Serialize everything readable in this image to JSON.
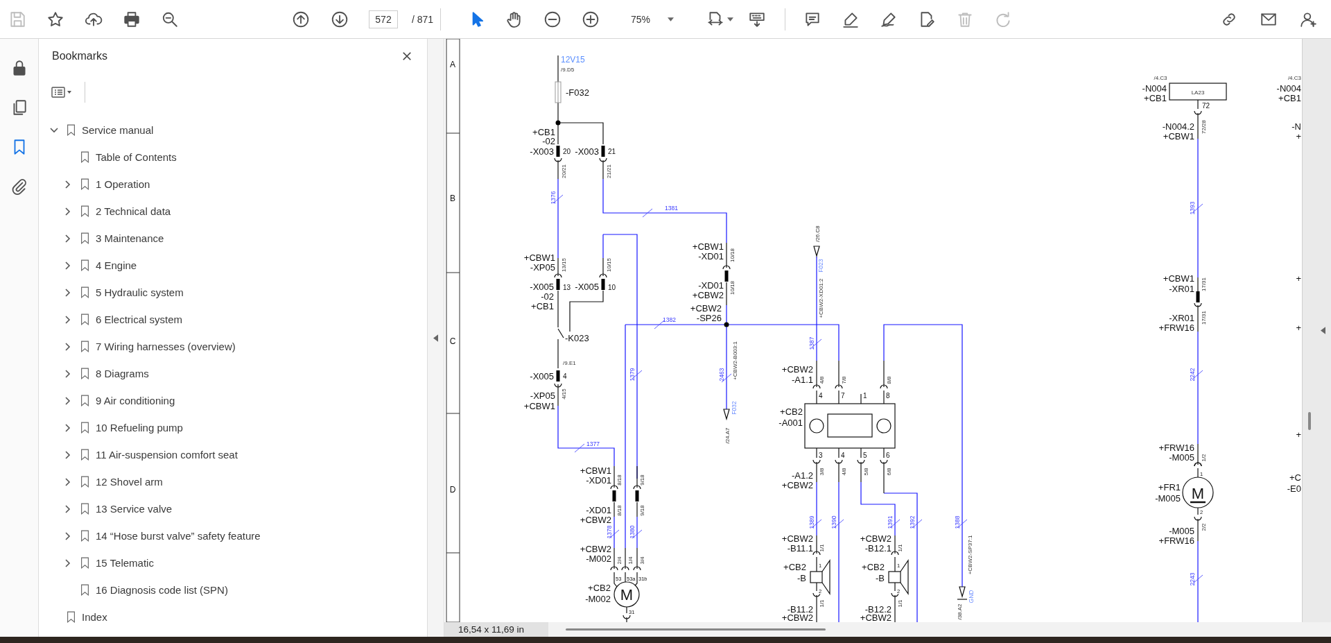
{
  "toolbar": {
    "file_tools": [
      {
        "kind": "save",
        "disabled": true
      },
      {
        "kind": "star",
        "disabled": false
      },
      {
        "kind": "upload",
        "disabled": false
      },
      {
        "kind": "print",
        "disabled": false
      },
      {
        "kind": "find",
        "disabled": false
      }
    ],
    "page_nav": [
      {
        "kind": "prev",
        "disabled": false
      },
      {
        "kind": "next",
        "disabled": false
      }
    ],
    "page_current": "572",
    "page_total": "/ 871",
    "modes": [
      {
        "kind": "select",
        "selected": true
      },
      {
        "kind": "hand",
        "selected": false
      }
    ],
    "zoom_buttons": [
      {
        "kind": "zoom_out",
        "disabled": false
      },
      {
        "kind": "zoom_in",
        "disabled": false
      }
    ],
    "zoom_value": "75%",
    "view_tools": [
      {
        "kind": "fit",
        "disabled": false
      },
      {
        "kind": "scroll",
        "disabled": false
      }
    ],
    "edit_tools": [
      {
        "kind": "comment",
        "disabled": false
      },
      {
        "kind": "highlight",
        "disabled": false
      },
      {
        "kind": "sign",
        "disabled": false
      },
      {
        "kind": "edit",
        "disabled": false
      },
      {
        "kind": "delete",
        "disabled": true
      },
      {
        "kind": "redo",
        "disabled": true
      }
    ],
    "account_tools": [
      {
        "kind": "link",
        "disabled": false
      },
      {
        "kind": "mail",
        "disabled": false
      },
      {
        "kind": "account",
        "disabled": false
      }
    ]
  },
  "nav": [
    {
      "kind": "lock",
      "selected": false
    },
    {
      "kind": "pages",
      "selected": false
    },
    {
      "kind": "bookmarks",
      "selected": true
    },
    {
      "kind": "attachments",
      "selected": false
    }
  ],
  "bookmarks": {
    "title": "Bookmarks",
    "items": [
      {
        "label": "Service manual",
        "expanded": true,
        "children": [
          {
            "label": "Table of Contents"
          },
          {
            "label": "1 Operation",
            "expanded": false
          },
          {
            "label": "2 Technical data",
            "expanded": false
          },
          {
            "label": "3 Maintenance",
            "expanded": false
          },
          {
            "label": "4 Engine",
            "expanded": false
          },
          {
            "label": "5 Hydraulic system",
            "expanded": false
          },
          {
            "label": "6 Electrical system",
            "expanded": false
          },
          {
            "label": "7 Wiring harnesses (overview)",
            "expanded": false
          },
          {
            "label": "8 Diagrams",
            "expanded": false
          },
          {
            "label": "9 Air conditioning",
            "expanded": false
          },
          {
            "label": "10 Refueling pump",
            "expanded": false
          },
          {
            "label": "11 Air-suspension comfort seat",
            "expanded": false
          },
          {
            "label": "12 Shovel arm",
            "expanded": false
          },
          {
            "label": "13 Service valve",
            "expanded": false
          },
          {
            "label": "14 “Hose burst valve” safety feature",
            "expanded": false
          },
          {
            "label": "15 Telematic",
            "expanded": false
          },
          {
            "label": "16 Diagnosis code list (SPN)"
          }
        ]
      },
      {
        "label": "Index"
      }
    ]
  },
  "diagram": {
    "labels": [
      {
        "text": "A",
        "kind": "row"
      },
      {
        "text": "B",
        "kind": "row"
      },
      {
        "text": "C",
        "kind": "row"
      },
      {
        "text": "D",
        "kind": "row"
      },
      {
        "text": "12V15",
        "kind": "supply"
      },
      {
        "text": "/9.D5",
        "kind": "ref"
      },
      {
        "text": "-F032",
        "kind": "tag"
      },
      {
        "text": "+CB1",
        "kind": "tag"
      },
      {
        "text": "-02",
        "kind": "tag"
      },
      {
        "text": "-X003",
        "kind": "tag"
      },
      {
        "text": "20",
        "kind": "pin"
      },
      {
        "text": "-X003",
        "kind": "tag"
      },
      {
        "text": "21",
        "kind": "pin"
      },
      {
        "text": "20/21",
        "kind": "core"
      },
      {
        "text": "21/21",
        "kind": "core"
      },
      {
        "text": "1376",
        "kind": "wire"
      },
      {
        "text": "1381",
        "kind": "wire"
      },
      {
        "text": "+CBW1",
        "kind": "tag"
      },
      {
        "text": "-XP05",
        "kind": "tag"
      },
      {
        "text": "13/15",
        "kind": "core"
      },
      {
        "text": "10/15",
        "kind": "core"
      },
      {
        "text": "-X005",
        "kind": "tag"
      },
      {
        "text": "13",
        "kind": "pin"
      },
      {
        "text": "-02",
        "kind": "tag"
      },
      {
        "text": "+CB1",
        "kind": "tag"
      },
      {
        "text": "-X005",
        "kind": "tag"
      },
      {
        "text": "10",
        "kind": "pin"
      },
      {
        "text": "+CBW1",
        "kind": "tag"
      },
      {
        "text": "-XD01",
        "kind": "tag"
      },
      {
        "text": "10/18",
        "kind": "core"
      },
      {
        "text": "-XD01",
        "kind": "tag"
      },
      {
        "text": "+CBW2",
        "kind": "tag"
      },
      {
        "text": "10/18",
        "kind": "core"
      },
      {
        "text": "1382",
        "kind": "wire"
      },
      {
        "text": "+CBW2",
        "kind": "tag"
      },
      {
        "text": "-SP26",
        "kind": "tag"
      },
      {
        "text": "-K023",
        "kind": "tag"
      },
      {
        "text": "/9.E1",
        "kind": "ref"
      },
      {
        "text": "-X005",
        "kind": "tag"
      },
      {
        "text": "4",
        "kind": "pin"
      },
      {
        "text": "-XP05",
        "kind": "tag"
      },
      {
        "text": "+CBW1",
        "kind": "tag"
      },
      {
        "text": "4/15",
        "kind": "core"
      },
      {
        "text": "1379",
        "kind": "wire"
      },
      {
        "text": "1377",
        "kind": "wire"
      },
      {
        "text": "+CBW1",
        "kind": "tag"
      },
      {
        "text": "-XD01",
        "kind": "tag"
      },
      {
        "text": "8/18",
        "kind": "core"
      },
      {
        "text": "9/18",
        "kind": "core"
      },
      {
        "text": "-XD01",
        "kind": "tag"
      },
      {
        "text": "+CBW2",
        "kind": "tag"
      },
      {
        "text": "8/18",
        "kind": "core"
      },
      {
        "text": "9/18",
        "kind": "core"
      },
      {
        "text": "1378",
        "kind": "wire"
      },
      {
        "text": "1380",
        "kind": "wire"
      },
      {
        "text": "+CBW2",
        "kind": "tag"
      },
      {
        "text": "-M002",
        "kind": "tag"
      },
      {
        "text": "2/4",
        "kind": "core"
      },
      {
        "text": "1/4",
        "kind": "core"
      },
      {
        "text": "3/4",
        "kind": "core"
      },
      {
        "text": "53",
        "kind": "pinsmall"
      },
      {
        "text": "53a",
        "kind": "pinsmall"
      },
      {
        "text": "31b",
        "kind": "pinsmall"
      },
      {
        "text": "+CB2",
        "kind": "tag"
      },
      {
        "text": "-M002",
        "kind": "tag"
      },
      {
        "text": "M",
        "kind": "motor"
      },
      {
        "text": "31",
        "kind": "pinsmall"
      },
      {
        "text": "2463",
        "kind": "wire"
      },
      {
        "text": "+CBW2-B003:1",
        "kind": "ref"
      },
      {
        "text": "F032",
        "kind": "signal"
      },
      {
        "text": "/24.A7",
        "kind": "ref"
      },
      {
        "text": "/26.C8",
        "kind": "ref"
      },
      {
        "text": "F023",
        "kind": "signal"
      },
      {
        "text": "+CBW2-XD01:2",
        "kind": "ref"
      },
      {
        "text": "1387",
        "kind": "wire"
      },
      {
        "text": "+CBW2",
        "kind": "tag"
      },
      {
        "text": "-A1.1",
        "kind": "tag"
      },
      {
        "text": "4/8",
        "kind": "core"
      },
      {
        "text": "7/8",
        "kind": "core"
      },
      {
        "text": "8/8",
        "kind": "core"
      },
      {
        "text": "4",
        "kind": "pin"
      },
      {
        "text": "7",
        "kind": "pin"
      },
      {
        "text": "1",
        "kind": "pin"
      },
      {
        "text": "8",
        "kind": "pin"
      },
      {
        "text": "+CB2",
        "kind": "tag"
      },
      {
        "text": "-A001",
        "kind": "tag"
      },
      {
        "text": "3",
        "kind": "pin"
      },
      {
        "text": "4",
        "kind": "pin"
      },
      {
        "text": "5",
        "kind": "pin"
      },
      {
        "text": "6",
        "kind": "pin"
      },
      {
        "text": "3/8",
        "kind": "core"
      },
      {
        "text": "4/8",
        "kind": "core"
      },
      {
        "text": "5/8",
        "kind": "core"
      },
      {
        "text": "6/8",
        "kind": "core"
      },
      {
        "text": "-A1.2",
        "kind": "tag"
      },
      {
        "text": "+CBW2",
        "kind": "tag"
      },
      {
        "text": "1389",
        "kind": "wire"
      },
      {
        "text": "1390",
        "kind": "wire"
      },
      {
        "text": "1391",
        "kind": "wire"
      },
      {
        "text": "1392",
        "kind": "wire"
      },
      {
        "text": "1388",
        "kind": "wire"
      },
      {
        "text": "+CBW2",
        "kind": "tag"
      },
      {
        "text": "-B11.1",
        "kind": "tag"
      },
      {
        "text": "1/1",
        "kind": "core"
      },
      {
        "text": "+CB2",
        "kind": "tag"
      },
      {
        "text": "1",
        "kind": "pinsmall"
      },
      {
        "text": "-B",
        "kind": "tag"
      },
      {
        "text": "2",
        "kind": "pinsmall"
      },
      {
        "text": "1/1",
        "kind": "core"
      },
      {
        "text": "-B11.2",
        "kind": "tag"
      },
      {
        "text": "+CBW2",
        "kind": "tag"
      },
      {
        "text": "+CBW2",
        "kind": "tag"
      },
      {
        "text": "-B12.1",
        "kind": "tag"
      },
      {
        "text": "1/1",
        "kind": "core"
      },
      {
        "text": "+CB2",
        "kind": "tag"
      },
      {
        "text": "1",
        "kind": "pinsmall"
      },
      {
        "text": "-B",
        "kind": "tag"
      },
      {
        "text": "2",
        "kind": "pinsmall"
      },
      {
        "text": "1/1",
        "kind": "core"
      },
      {
        "text": "-B12.2",
        "kind": "tag"
      },
      {
        "text": "+CBW2",
        "kind": "tag"
      },
      {
        "text": "+CBW2-SP37:1",
        "kind": "ref"
      },
      {
        "text": "GND",
        "kind": "signal"
      },
      {
        "text": "/38.A2",
        "kind": "ref"
      },
      {
        "text": "/4.C3",
        "kind": "ref"
      },
      {
        "text": "-N004",
        "kind": "tag"
      },
      {
        "text": "+CB1",
        "kind": "tag"
      },
      {
        "text": "LA23",
        "kind": "ref"
      },
      {
        "text": "72",
        "kind": "pin"
      },
      {
        "text": "-N004.2",
        "kind": "tag"
      },
      {
        "text": "+CBW1",
        "kind": "tag"
      },
      {
        "text": "72/28",
        "kind": "core"
      },
      {
        "text": "1393",
        "kind": "wire"
      },
      {
        "text": "+CBW1",
        "kind": "tag"
      },
      {
        "text": "-XR01",
        "kind": "tag"
      },
      {
        "text": "17/31",
        "kind": "core"
      },
      {
        "text": "-XR01",
        "kind": "tag"
      },
      {
        "text": "+FRW16",
        "kind": "tag"
      },
      {
        "text": "17/31",
        "kind": "core"
      },
      {
        "text": "2242",
        "kind": "wire"
      },
      {
        "text": "+FRW16",
        "kind": "tag"
      },
      {
        "text": "-M005",
        "kind": "tag"
      },
      {
        "text": "1/2",
        "kind": "core"
      },
      {
        "text": "1",
        "kind": "pinsmall"
      },
      {
        "text": "M",
        "kind": "motor"
      },
      {
        "text": "+FR1",
        "kind": "tag"
      },
      {
        "text": "-M005",
        "kind": "tag"
      },
      {
        "text": "2",
        "kind": "pinsmall"
      },
      {
        "text": "-M005",
        "kind": "tag"
      },
      {
        "text": "+FRW16",
        "kind": "tag"
      },
      {
        "text": "2/2",
        "kind": "core"
      },
      {
        "text": "2243",
        "kind": "wire"
      },
      {
        "text": "/4.C3",
        "kind": "ref"
      },
      {
        "text": "-N004",
        "kind": "tag"
      },
      {
        "text": "+CB1",
        "kind": "tag"
      },
      {
        "text": "-N",
        "kind": "tag"
      },
      {
        "text": "+",
        "kind": "tag"
      },
      {
        "text": "+",
        "kind": "tag"
      },
      {
        "text": "+",
        "kind": "tag"
      },
      {
        "text": "+",
        "kind": "tag"
      },
      {
        "text": "+C",
        "kind": "tag"
      },
      {
        "text": "-E0",
        "kind": "tag"
      }
    ]
  },
  "status_bar": {
    "page_size": "16,54 x 11,69 in"
  }
}
